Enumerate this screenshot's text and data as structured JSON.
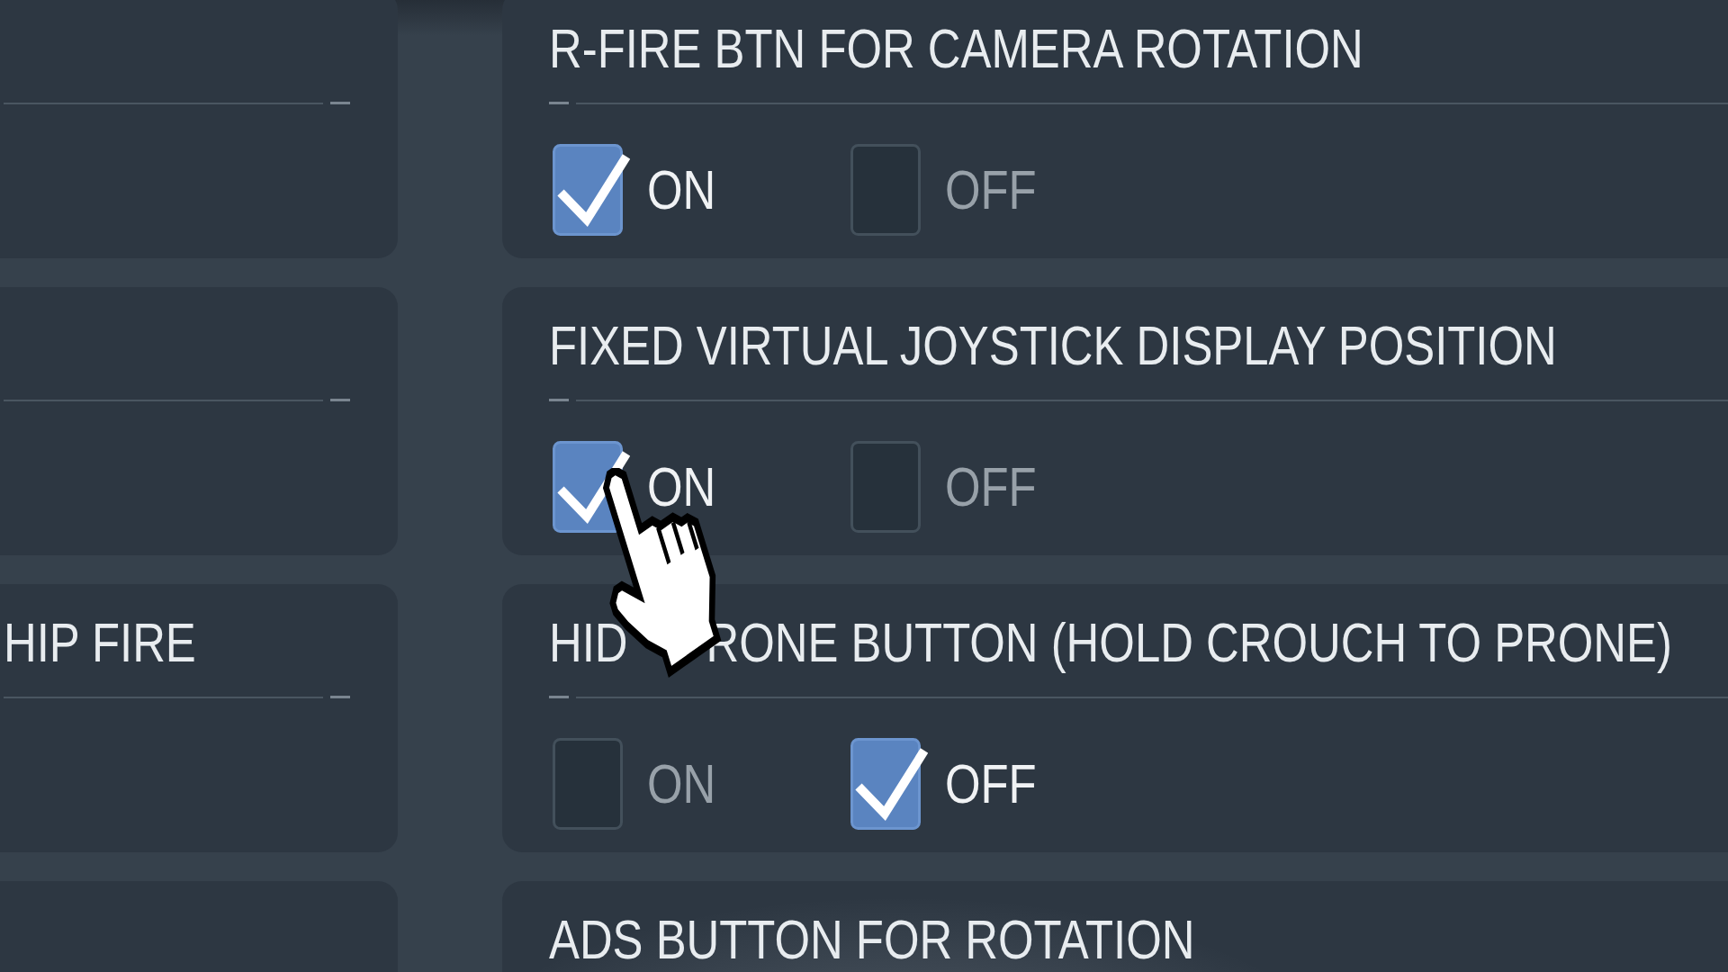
{
  "left_panels": [
    {
      "kind": "blank"
    },
    {
      "kind": "blank"
    },
    {
      "kind": "titled",
      "title": "HIP FIRE"
    },
    {
      "kind": "blank"
    }
  ],
  "settings": [
    {
      "title": "R-FIRE BTN FOR CAMERA ROTATION",
      "options": [
        {
          "label": "ON",
          "checked": true
        },
        {
          "label": "OFF",
          "checked": false
        }
      ]
    },
    {
      "title": "FIXED VIRTUAL JOYSTICK DISPLAY POSITION",
      "options": [
        {
          "label": "ON",
          "checked": true
        },
        {
          "label": "OFF",
          "checked": false
        }
      ]
    },
    {
      "title_parts": [
        "HID",
        "RONE BUTTON (HOLD CROUCH TO PRONE)"
      ],
      "options": [
        {
          "label": "ON",
          "checked": false
        },
        {
          "label": "OFF",
          "checked": true
        }
      ]
    },
    {
      "title": "ADS BUTTON FOR ROTATION"
    }
  ]
}
